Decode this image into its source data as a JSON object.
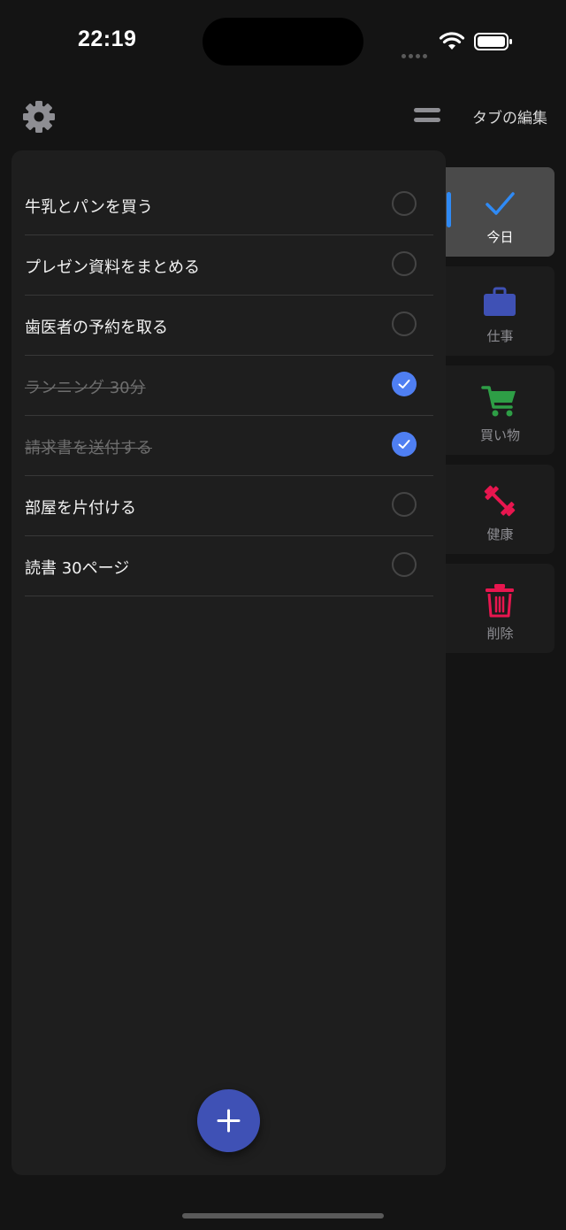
{
  "status_bar": {
    "time": "22:19"
  },
  "header": {
    "edit_tabs_label": "タブの編集",
    "settings_icon": "gear-icon",
    "menu_icon": "menu-icon"
  },
  "tasks": [
    {
      "text": "牛乳とパンを買う",
      "done": false
    },
    {
      "text": "プレゼン資料をまとめる",
      "done": false
    },
    {
      "text": "歯医者の予約を取る",
      "done": false
    },
    {
      "text": "ランニング 30分",
      "done": true
    },
    {
      "text": "請求書を送付する",
      "done": true
    },
    {
      "text": "部屋を片付ける",
      "done": false
    },
    {
      "text": "読書 30ページ",
      "done": false
    }
  ],
  "tabs": [
    {
      "label": "今日",
      "icon": "checkmark-icon",
      "color": "#2f8af5",
      "active": true
    },
    {
      "label": "仕事",
      "icon": "briefcase-icon",
      "color": "#3f51b5",
      "active": false
    },
    {
      "label": "買い物",
      "icon": "cart-icon",
      "color": "#2e9e46",
      "active": false
    },
    {
      "label": "健康",
      "icon": "dumbbell-icon",
      "color": "#e8164f",
      "active": false
    },
    {
      "label": "削除",
      "icon": "trash-icon",
      "color": "#e8164f",
      "active": false
    }
  ],
  "colors": {
    "background": "#141414",
    "panel": "#1e1e1e",
    "accent": "#4f7ff2",
    "fab": "#3f51b5"
  },
  "fab": {
    "icon": "plus-icon"
  }
}
